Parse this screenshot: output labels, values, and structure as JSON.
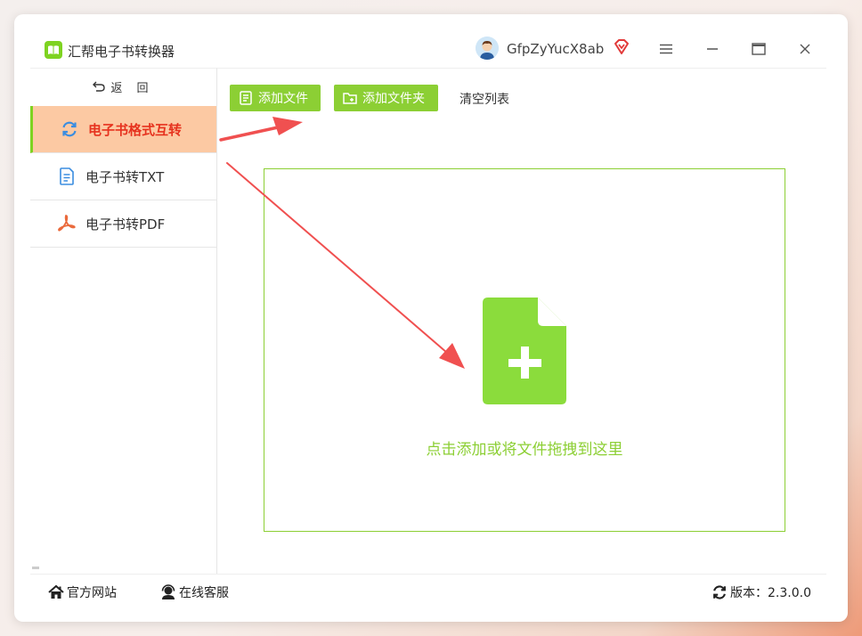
{
  "app": {
    "title": "汇帮电子书转换器",
    "username": "GfpZyYucX8ab"
  },
  "sidebar": {
    "back_label": "返 回",
    "items": [
      {
        "label": "电子书格式互转",
        "icon": "refresh-icon",
        "active": true
      },
      {
        "label": "电子书转TXT",
        "icon": "document-icon",
        "active": false
      },
      {
        "label": "电子书转PDF",
        "icon": "pdf-icon",
        "active": false
      }
    ]
  },
  "toolbar": {
    "add_file_label": "添加文件",
    "add_folder_label": "添加文件夹",
    "clear_label": "清空列表"
  },
  "dropzone": {
    "hint": "点击添加或将文件拖拽到这里"
  },
  "footer": {
    "website_label": "官方网站",
    "support_label": "在线客服",
    "version_label": "版本：2.3.0.0"
  },
  "colors": {
    "accent_green": "#8ccf34",
    "active_bg": "#fcc9a3",
    "active_text": "#e6321e",
    "arrow_red": "#f05050"
  }
}
